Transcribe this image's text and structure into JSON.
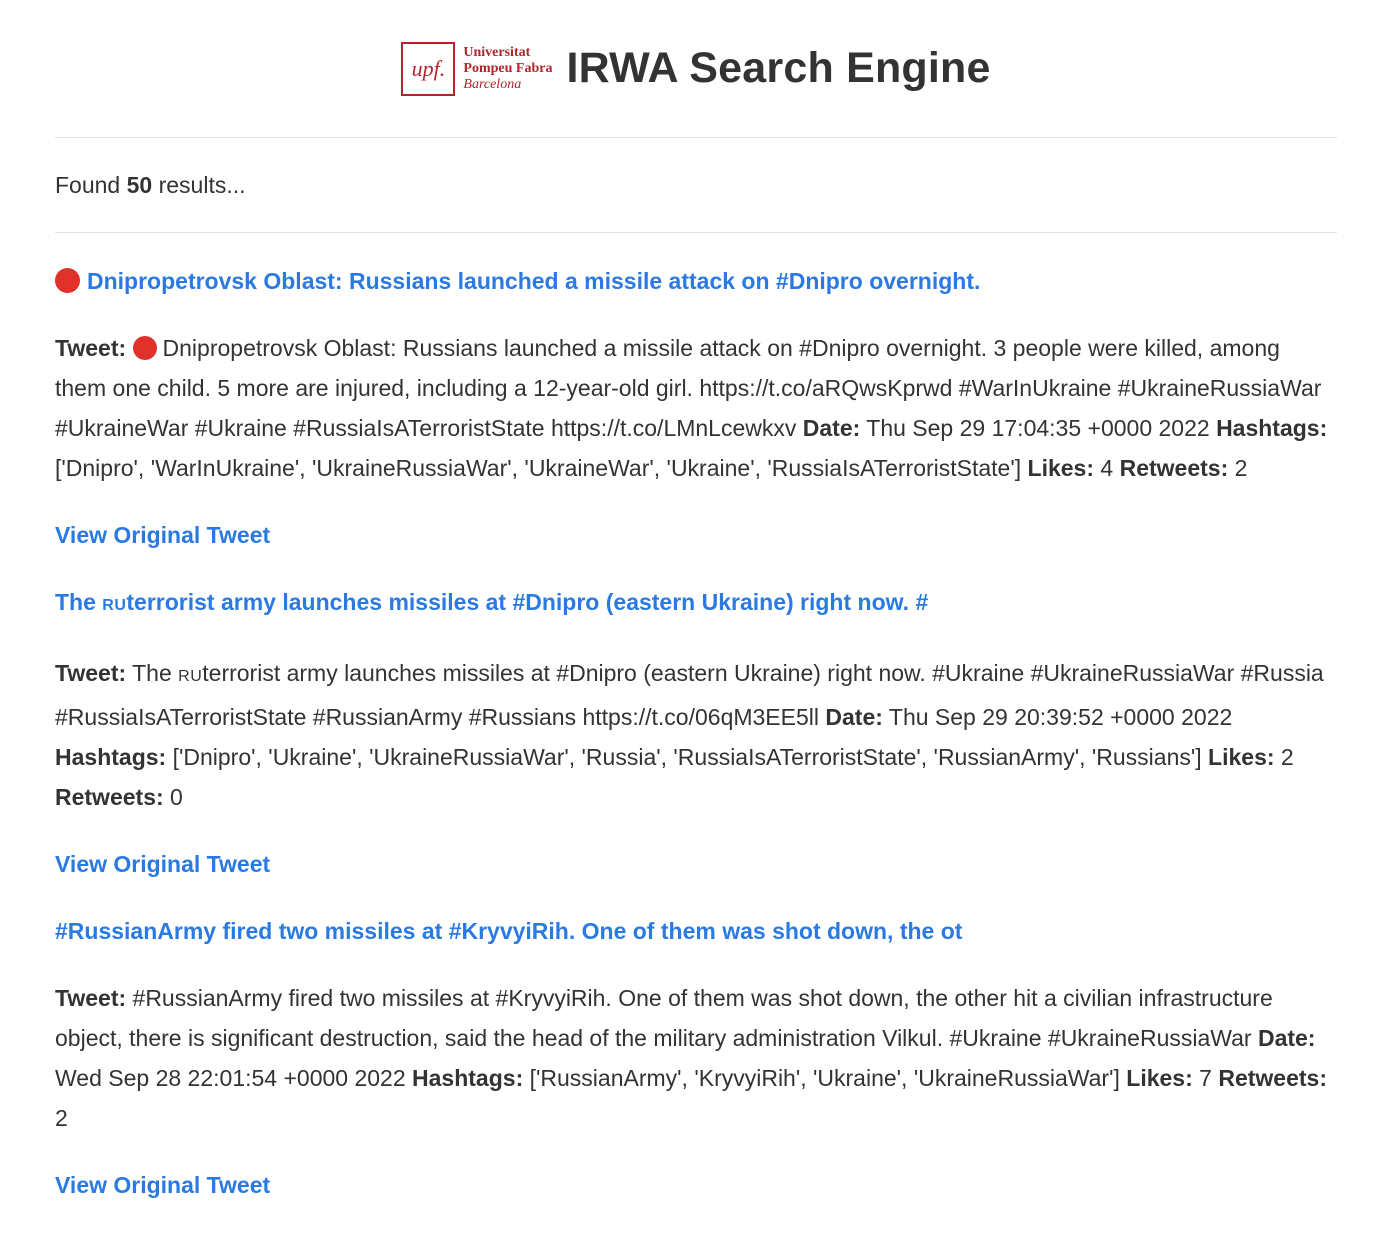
{
  "header": {
    "logo_mark": "upf.",
    "logo_line1": "Universitat",
    "logo_line2": "Pompeu Fabra",
    "logo_line3": "Barcelona",
    "title": "IRWA Search Engine"
  },
  "summary": {
    "prefix": "Found",
    "count": "50",
    "suffix": "results..."
  },
  "labels": {
    "tweet": "Tweet:",
    "date": "Date:",
    "hashtags": "Hashtags:",
    "likes": "Likes:",
    "retweets": "Retweets:",
    "view_original": "View Original Tweet"
  },
  "results": [
    {
      "title": "Dnipropetrovsk Oblast: Russians launched a missile attack on #Dnipro overnight.",
      "text": "Dnipropetrovsk Oblast: Russians launched a missile attack on #Dnipro overnight. 3 people were killed, among them one child. 5 more are injured, including a 12-year-old girl. https://t.co/aRQwsKprwd #WarInUkraine #UkraineRussiaWar #UkraineWar #Ukraine #RussiaIsATerroristState https://t.co/LMnLcewkxv",
      "date": "Thu Sep 29 17:04:35 +0000 2022",
      "hashtags": "['Dnipro', 'WarInUkraine', 'UkraineRussiaWar', 'UkraineWar', 'Ukraine', 'RussiaIsATerroristState']",
      "likes": "4",
      "retweets": "2"
    },
    {
      "title_pre": "The ",
      "title_flag": "RU",
      "title_post": "terrorist army launches missiles at #Dnipro (eastern Ukraine) right now. #",
      "text_pre": "The ",
      "text_flag": "RU",
      "text_post": "terrorist army launches missiles at #Dnipro (eastern Ukraine) right now. #Ukraine #UkraineRussiaWar #Russia #RussiaIsATerroristState #RussianArmy #Russians https://t.co/06qM3EE5ll",
      "date": "Thu Sep 29 20:39:52 +0000 2022",
      "hashtags": "['Dnipro', 'Ukraine', 'UkraineRussiaWar', 'Russia', 'RussiaIsATerroristState', 'RussianArmy', 'Russians']",
      "likes": "2",
      "retweets": "0"
    },
    {
      "title": "#RussianArmy fired two missiles at #KryvyiRih. One of them was shot down, the ot",
      "text": "#RussianArmy fired two missiles at #KryvyiRih. One of them was shot down, the other hit a civilian infrastructure object, there is significant destruction, said the head of the military administration Vilkul. #Ukraine #UkraineRussiaWar",
      "date": "Wed Sep 28 22:01:54 +0000 2022",
      "hashtags": "['RussianArmy', 'KryvyiRih', 'Ukraine', 'UkraineRussiaWar']",
      "likes": "7",
      "retweets": "2"
    }
  ]
}
